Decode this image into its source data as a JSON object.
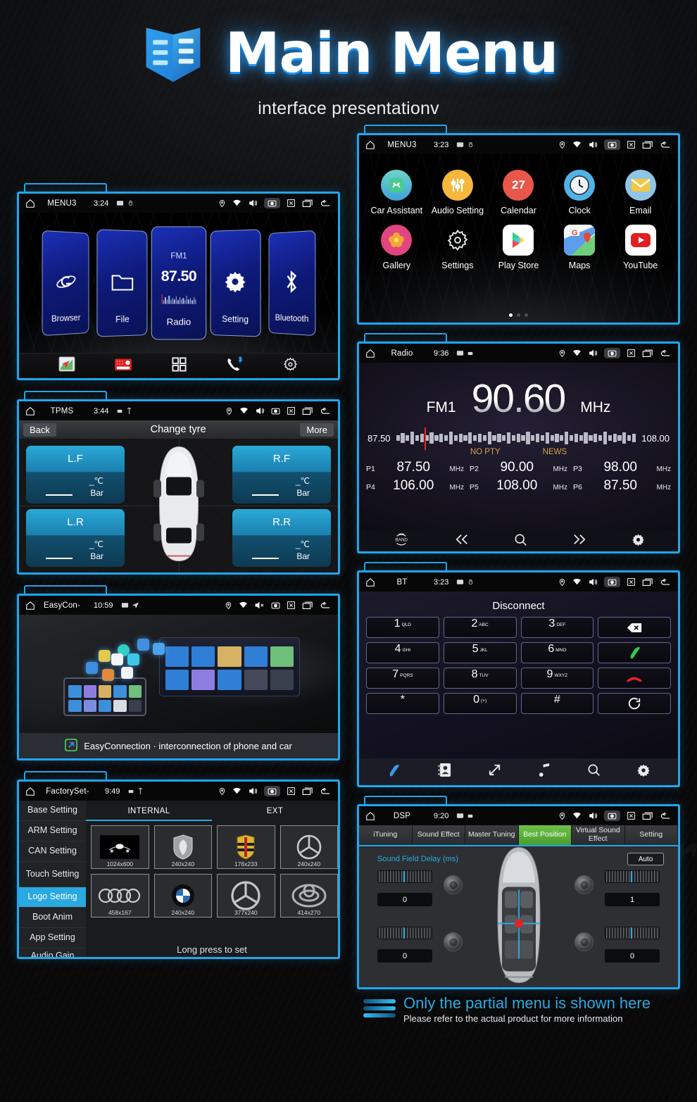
{
  "header": {
    "title": "Main Menu",
    "subtitle": "interface presentationv",
    "logo_icon": "shield-book-icon"
  },
  "statusbar_icons": [
    "home-icon",
    "location-pin-icon",
    "wifi-icon",
    "volume-icon",
    "screenshot-icon",
    "close-icon",
    "recents-icon",
    "back-icon"
  ],
  "panels": {
    "main_menu": {
      "status": {
        "app": "MENU3",
        "time": "3:24"
      },
      "cards": [
        {
          "label": "Browser",
          "icon": "browser-icon"
        },
        {
          "label": "File",
          "icon": "folder-icon"
        },
        {
          "label": "Radio",
          "icon": "radio-tuner",
          "band": "FM1",
          "freq": "87.50"
        },
        {
          "label": "Setting",
          "icon": "gear-icon"
        },
        {
          "label": "Bluetooth",
          "icon": "bluetooth-icon"
        }
      ],
      "dock": [
        "navigation-icon",
        "radio-icon",
        "apps-grid-icon",
        "bluetooth-phone-icon",
        "settings-icon"
      ]
    },
    "tpms": {
      "status": {
        "app": "TPMS",
        "time": "3:44"
      },
      "back_label": "Back",
      "title": "Change tyre",
      "more_label": "More",
      "tyres": [
        {
          "pos": "L.F",
          "temp": "_℃",
          "pressure": "Bar"
        },
        {
          "pos": "R.F",
          "temp": "_℃",
          "pressure": "Bar"
        },
        {
          "pos": "L.R",
          "temp": "_℃",
          "pressure": "Bar"
        },
        {
          "pos": "R.R",
          "temp": "_℃",
          "pressure": "Bar"
        }
      ]
    },
    "easyconnection": {
      "status": {
        "app": "EasyCon-",
        "time": "10:59"
      },
      "caption": "EasyConnection · interconnection of phone and car",
      "caption_icon": "easyconnection-icon"
    },
    "factoryset": {
      "status": {
        "app": "FactorySet-",
        "time": "9:49"
      },
      "sidebar": [
        "Base Setting",
        "ARM Setting",
        "CAN Setting",
        "Touch Setting",
        "Logo Setting",
        "Boot Anim",
        "App Setting",
        "Audio Gain Setting"
      ],
      "active_sidebar": "Logo Setting",
      "tabs": [
        "INTERNAL",
        "EXT"
      ],
      "active_tab": "INTERNAL",
      "logos": [
        {
          "name": "default-car-logo",
          "size": "1024x600"
        },
        {
          "name": "peugeot-logo",
          "size": "240x240"
        },
        {
          "name": "porsche-logo",
          "size": "176x233"
        },
        {
          "name": "mercedes-logo",
          "size": "240x240"
        },
        {
          "name": "audi-logo",
          "size": "458x167"
        },
        {
          "name": "bmw-logo",
          "size": "240x240"
        },
        {
          "name": "mercedes-logo-2",
          "size": "377x240"
        },
        {
          "name": "toyota-logo",
          "size": "414x270"
        }
      ],
      "hint": "Long press to set"
    },
    "app_grid": {
      "status": {
        "app": "MENU3",
        "time": "3:23"
      },
      "apps": [
        {
          "label": "Car Assistant",
          "icon": "car-assistant-icon",
          "color": "#49c9a7"
        },
        {
          "label": "Audio Setting",
          "icon": "sliders-icon",
          "color": "#f5b73c"
        },
        {
          "label": "Calendar",
          "icon": "calendar-icon",
          "color": "#e8574a",
          "day": "27"
        },
        {
          "label": "Clock",
          "icon": "clock-icon",
          "color": "#4fb3e8"
        },
        {
          "label": "Email",
          "icon": "email-icon",
          "color": "#f0c24a"
        },
        {
          "label": "Gallery",
          "icon": "gallery-flower-icon",
          "color": "#e0457f"
        },
        {
          "label": "Settings",
          "icon": "settings-gear-icon",
          "color": "#000000"
        },
        {
          "label": "Play Store",
          "icon": "play-store-icon",
          "color": "#ffffff"
        },
        {
          "label": "Maps",
          "icon": "maps-icon",
          "color": "#ffffff"
        },
        {
          "label": "YouTube",
          "icon": "youtube-icon",
          "color": "#ffffff"
        }
      ],
      "page_dots": 3,
      "active_dot": 1
    },
    "radio": {
      "status": {
        "app": "Radio",
        "time": "9:36"
      },
      "band": "FM1",
      "frequency": "90.60",
      "unit": "MHz",
      "scale_min": "87.50",
      "scale_max": "108.00",
      "pty": "NO PTY",
      "news": "NEWS",
      "presets": [
        {
          "id": "P1",
          "freq": "87.50",
          "unit": "MHz"
        },
        {
          "id": "P2",
          "freq": "90.00",
          "unit": "MHz"
        },
        {
          "id": "P3",
          "freq": "98.00",
          "unit": "MHz"
        },
        {
          "id": "P4",
          "freq": "106.00",
          "unit": "MHz"
        },
        {
          "id": "P5",
          "freq": "108.00",
          "unit": "MHz"
        },
        {
          "id": "P6",
          "freq": "87.50",
          "unit": "MHz"
        }
      ],
      "dock": [
        "band-icon",
        "prev-icon",
        "search-icon",
        "next-icon",
        "settings-icon"
      ]
    },
    "bluetooth": {
      "status": {
        "app": "BT",
        "time": "3:23"
      },
      "title": "Disconnect",
      "keys": [
        {
          "num": "1",
          "sub": "QLD"
        },
        {
          "num": "2",
          "sub": "ABC"
        },
        {
          "num": "3",
          "sub": "DEF"
        },
        {
          "num": "",
          "sub": "",
          "icon": "backspace-icon"
        },
        {
          "num": "4",
          "sub": "GHI"
        },
        {
          "num": "5",
          "sub": "JKL"
        },
        {
          "num": "6",
          "sub": "MNO"
        },
        {
          "num": "",
          "sub": "",
          "icon": "call-answer-icon"
        },
        {
          "num": "7",
          "sub": "PQRS"
        },
        {
          "num": "8",
          "sub": "TUV"
        },
        {
          "num": "9",
          "sub": "WXYZ"
        },
        {
          "num": "",
          "sub": "",
          "icon": "call-end-icon"
        },
        {
          "num": "*",
          "sub": ""
        },
        {
          "num": "0",
          "sub": "(+)"
        },
        {
          "num": "#",
          "sub": ""
        },
        {
          "num": "",
          "sub": "",
          "icon": "sync-icon"
        }
      ],
      "dock": [
        "dialpad-phone-icon",
        "contacts-icon",
        "call-log-icon",
        "music-icon",
        "search-icon",
        "settings-icon"
      ]
    },
    "dsp": {
      "status": {
        "app": "DSP",
        "time": "9:20"
      },
      "tabs": [
        "iTuning",
        "Sound Effect",
        "Master Tuning",
        "Best Position",
        "Virtual Sound Effect",
        "Setting"
      ],
      "active_tab": "Best Position",
      "section_label": "Sound Field Delay (ms)",
      "auto_label": "Auto",
      "delays": [
        {
          "pos": "front-left",
          "value": "0"
        },
        {
          "pos": "front-right",
          "value": "1"
        },
        {
          "pos": "rear-left",
          "value": "0"
        },
        {
          "pos": "rear-right",
          "value": "0"
        }
      ]
    }
  },
  "footer": {
    "line1": "Only the partial menu is shown here",
    "line2": "Please refer to the actual product for more information"
  },
  "colors": {
    "accent_blue": "#1ea7ef",
    "tab_green": "#4a9e2c",
    "highlight": "#2aa8e0"
  }
}
